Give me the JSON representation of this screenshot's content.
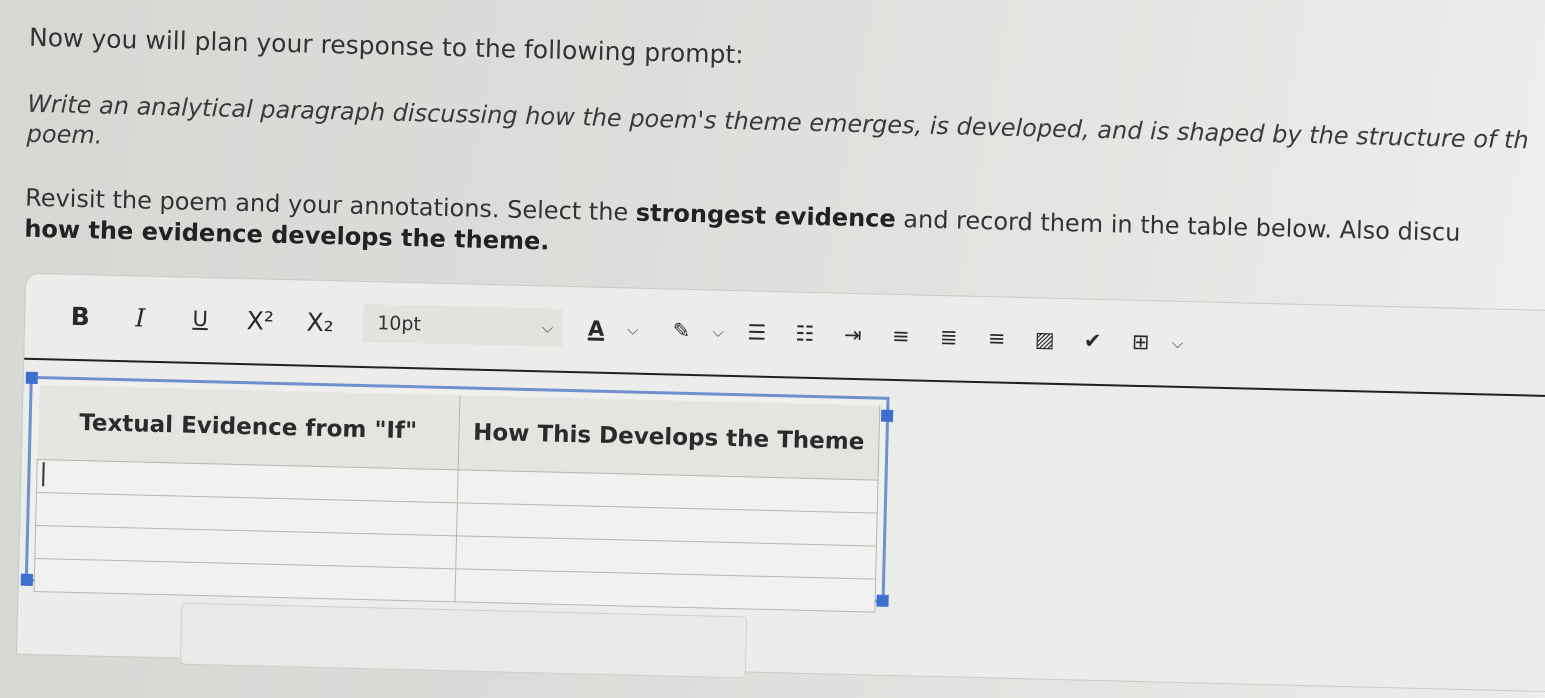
{
  "intro": "Now you will plan your response to the following prompt:",
  "prompt_line1": "Write an analytical paragraph discussing how the poem's theme emerges, is developed, and is shaped by the structure of th",
  "prompt_line2": "poem.",
  "instr_pre": "Revisit the poem and your annotations. Select the ",
  "instr_bold": "strongest evidence",
  "instr_post": " and record them in the table below. Also discu",
  "instr_line2": "how the evidence develops the theme.",
  "toolbar": {
    "bold": "B",
    "italic": "I",
    "underline": "U",
    "superscript": "X²",
    "subscript": "X₂",
    "font_size": "10pt",
    "font_color": "A"
  },
  "table": {
    "headers": [
      "Textual Evidence from \"If\"",
      "How This Develops the Theme"
    ],
    "rows": [
      [
        "",
        ""
      ],
      [
        "",
        ""
      ],
      [
        "",
        ""
      ],
      [
        "",
        ""
      ]
    ]
  },
  "colors": {
    "selection": "#6f90cf",
    "handle": "#3d6fcf"
  }
}
